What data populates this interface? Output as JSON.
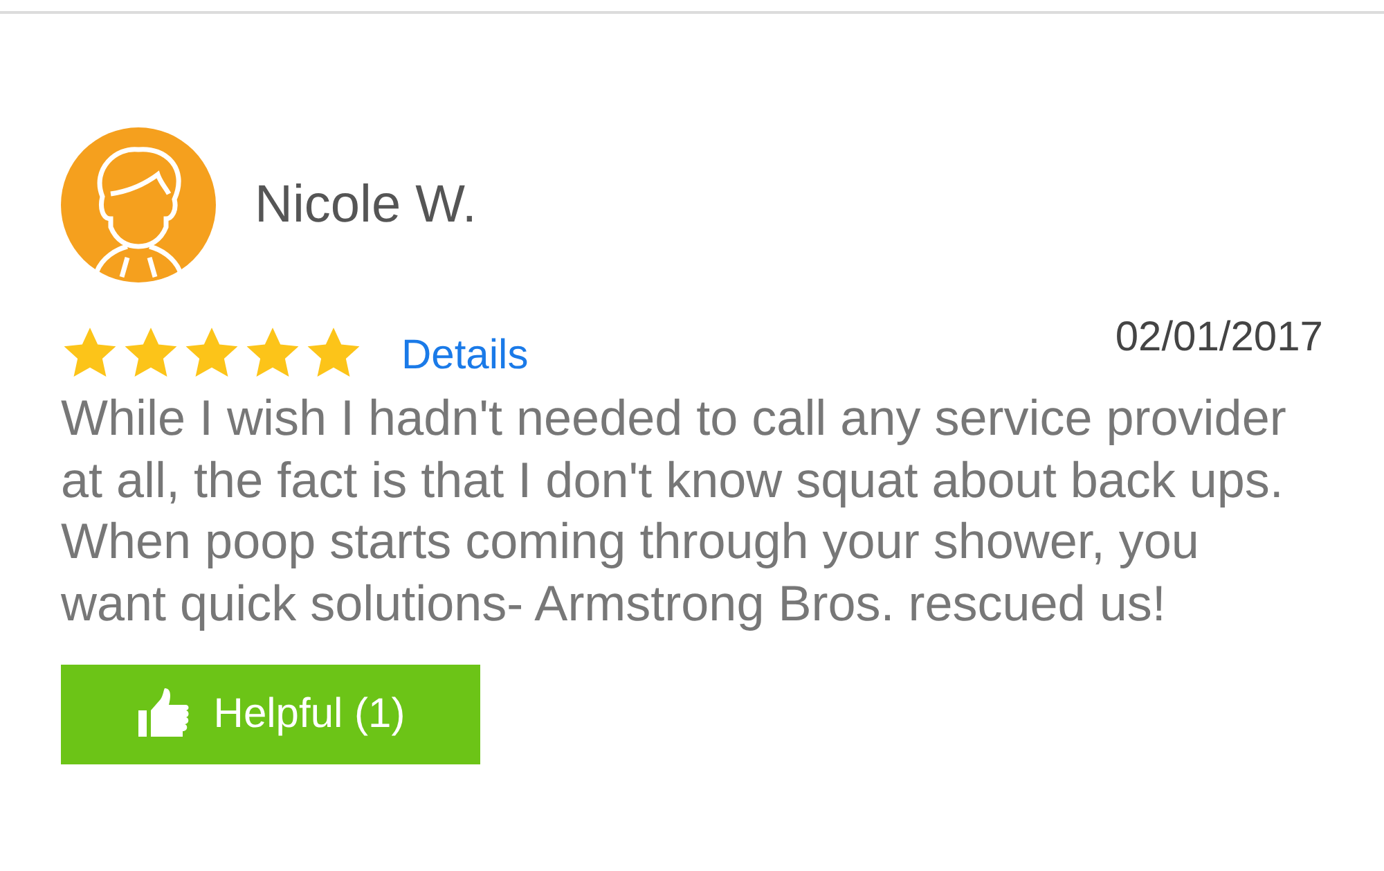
{
  "review": {
    "author": "Nicole W.",
    "stars": 5,
    "details_link": "Details",
    "date": "02/01/2017",
    "text": "While I wish I hadn't needed to call any service provider at all, the fact is that I don't know squat about back ups. When poop starts coming through your shower, you want quick solutions- Armstrong Bros. rescued us!",
    "helpful_button": "Helpful (1)"
  }
}
